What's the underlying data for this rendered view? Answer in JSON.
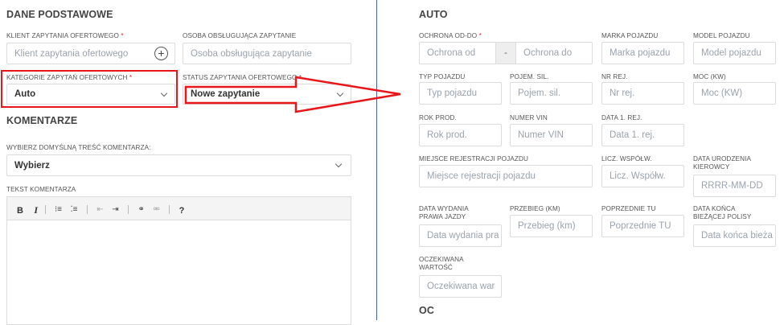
{
  "left": {
    "basic_title": "DANE PODSTAWOWE",
    "client_label": "KLIENT ZAPYTANIA OFERTOWEGO",
    "client_placeholder": "Klient zapytania ofertowego",
    "handler_label": "OSOBA OBSŁUGUJĄCA ZAPYTANIE",
    "handler_placeholder": "Osoba obsługująca zapytanie",
    "category_label": "KATEGORIE ZAPYTAŃ OFERTOWYCH",
    "category_value": "Auto",
    "status_label": "STATUS ZAPYTANIA OFERTOWEGO",
    "status_value": "Nowe zapytanie",
    "comments_title": "KOMENTARZE",
    "default_comment_label": "WYBIERZ DOMYŚLNĄ TREŚĆ KOMENTARZA:",
    "default_comment_value": "Wybierz",
    "comment_text_label": "TEKST KOMENTARZA",
    "toolbar": {
      "bold": "B",
      "italic": "I",
      "ordered_list": "⁝≡",
      "bullet_list": "⁚≡",
      "outdent": "⇤",
      "indent": "⇥",
      "link": "⚭",
      "unlink": "⚮",
      "help": "?"
    },
    "required_mark": "*",
    "add_icon": "+"
  },
  "auto": {
    "title": "AUTO",
    "protection_label": "OCHRONA OD-DO",
    "protection_from_placeholder": "Ochrona od",
    "protection_separator": "-",
    "protection_to_placeholder": "Ochrona do",
    "brand_label": "MARKA POJAZDU",
    "brand_placeholder": "Marka pojazdu",
    "model_label": "MODEL POJAZDU",
    "model_placeholder": "Model pojazdu",
    "type_label": "TYP POJAZDU",
    "type_placeholder": "Typ pojazdu",
    "capacity_label": "POJEM. SIL.",
    "capacity_placeholder": "Pojem. sil.",
    "reg_label": "NR REJ.",
    "reg_placeholder": "Nr rej.",
    "power_label": "MOC (KW)",
    "power_placeholder": "Moc (KW)",
    "year_label": "ROK PROD.",
    "year_placeholder": "Rok prod.",
    "vin_label": "NUMER VIN",
    "vin_placeholder": "Numer VIN",
    "first_reg_label": "DATA 1. REJ.",
    "first_reg_placeholder": "Data 1. rej.",
    "reg_place_label": "MIEJSCE REJESTRACJI POJAZDU",
    "reg_place_placeholder": "Miejsce rejestracji pojazdu",
    "owners_label": "LICZ. WSPÓŁW.",
    "owners_placeholder": "Licz. Współw.",
    "driver_birth_label_1": "DATA URODZENIA",
    "driver_birth_label_2": "KIEROWCY",
    "driver_birth_placeholder": "RRRR-MM-DD",
    "license_date_label_1": "DATA WYDANIA",
    "license_date_label_2": "PRAWA JAZDY",
    "license_date_placeholder": "Data wydania pra",
    "mileage_label": "PRZEBIEG (KM)",
    "mileage_placeholder": "Przebieg (km)",
    "prev_tu_label": "POPRZEDNIE TU",
    "prev_tu_placeholder": "Poprzednie TU",
    "policy_end_label_1": "DATA KOŃCA",
    "policy_end_label_2": "BIEŻĄCEJ POLISY",
    "policy_end_placeholder": "Data końca bieża",
    "expected_value_label_1": "OCZEKIWANA",
    "expected_value_label_2": "WARTOŚĆ",
    "expected_value_placeholder": "Oczekiwana war",
    "oc_title": "OC"
  },
  "colors": {
    "highlight_red": "#e8161b",
    "divider_blue": "#4a5ec4",
    "required_red": "#d9262d"
  }
}
